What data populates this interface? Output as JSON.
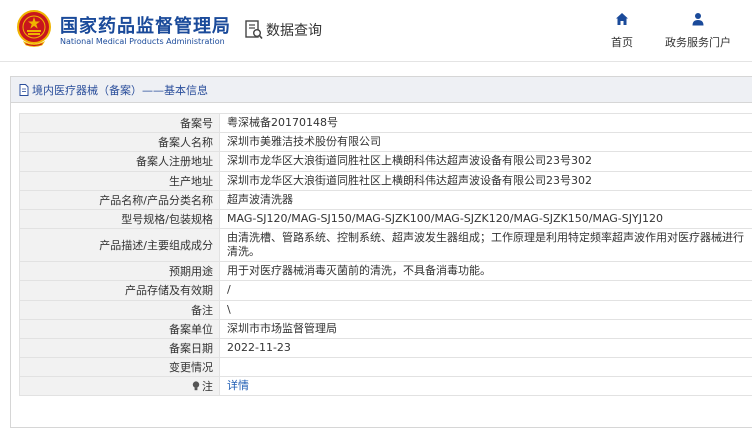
{
  "header": {
    "site_title": "国家药品监督管理局",
    "site_subtitle": "National Medical Products Administration",
    "query_label": "数据查询",
    "nav": {
      "home_label": "首页",
      "portal_label": "政务服务门户"
    }
  },
  "panel": {
    "title": "境内医疗器械（备案）——基本信息"
  },
  "record": {
    "rows": [
      {
        "label": "备案号",
        "value": "粤深械备20170148号"
      },
      {
        "label": "备案人名称",
        "value": "深圳市美雅洁技术股份有限公司"
      },
      {
        "label": "备案人注册地址",
        "value": "深圳市龙华区大浪街道同胜社区上横朗科伟达超声波设备有限公司23号302"
      },
      {
        "label": "生产地址",
        "value": "深圳市龙华区大浪街道同胜社区上横朗科伟达超声波设备有限公司23号302"
      },
      {
        "label": "产品名称/产品分类名称",
        "value": "超声波清洗器"
      },
      {
        "label": "型号规格/包装规格",
        "value": "MAG-SJ120/MAG-SJ150/MAG-SJZK100/MAG-SJZK120/MAG-SJZK150/MAG-SJYJ120"
      },
      {
        "label": "产品描述/主要组成成分",
        "value": "由清洗槽、管路系统、控制系统、超声波发生器组成；工作原理是利用特定频率超声波作用对医疗器械进行清洗。"
      },
      {
        "label": "预期用途",
        "value": "用于对医疗器械消毒灭菌前的清洗，不具备消毒功能。"
      },
      {
        "label": "产品存储及有效期",
        "value": "/"
      },
      {
        "label": "备注",
        "value": "\\"
      },
      {
        "label": "备案单位",
        "value": "深圳市市场监督管理局"
      },
      {
        "label": "备案日期",
        "value": "2022-11-23"
      },
      {
        "label": "变更情况",
        "value": ""
      }
    ],
    "note_label": "注",
    "detail_link": "详情"
  },
  "colors": {
    "brand_blue": "#1a4a9a",
    "emblem_red": "#c8161d",
    "emblem_gold": "#f0b400",
    "link_blue": "#1e5cb3"
  },
  "icons": [
    "national-emblem-icon",
    "data-query-icon",
    "home-icon",
    "user-icon",
    "document-icon",
    "lightbulb-icon"
  ]
}
